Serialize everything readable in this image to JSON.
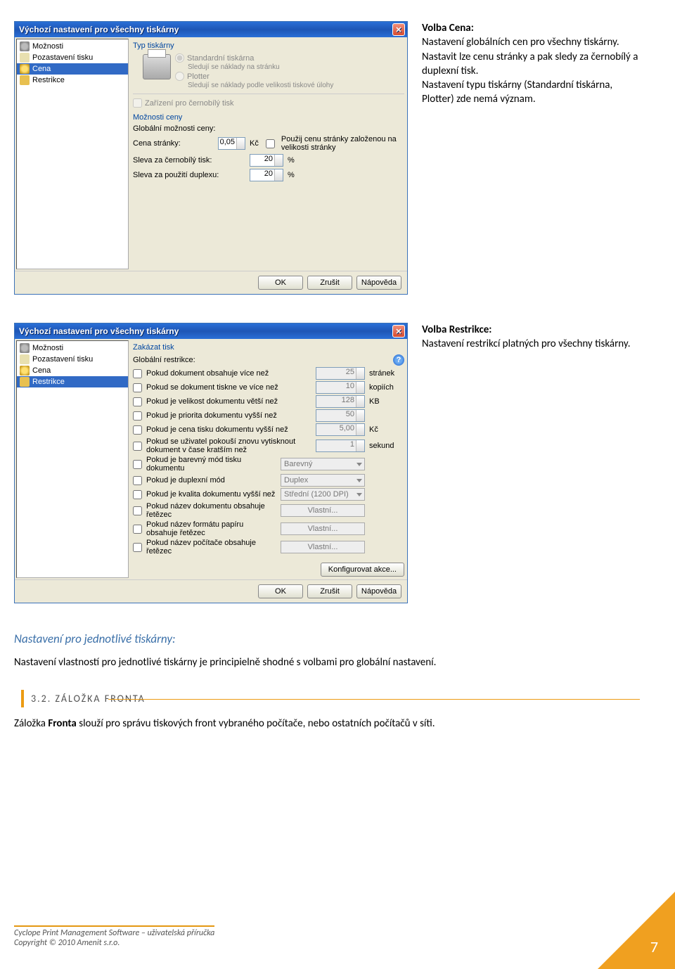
{
  "dialog1": {
    "title": "Výchozí nastavení pro všechny tiskárny",
    "sidebar": [
      "Možnosti",
      "Pozastavení tisku",
      "Cena",
      "Restrikce"
    ],
    "selected": 2,
    "group_type": "Typ tiskárny",
    "opt_standard": "Standardní tiskárna",
    "opt_standard_sub": "Sledují se náklady na stránku",
    "opt_plotter": "Plotter",
    "opt_plotter_sub": "Sledují se náklady podle velikosti tiskové úlohy",
    "chk_bw": "Zařízení pro černobílý tisk",
    "group_price": "Možnosti ceny",
    "lbl_global": "Globální možnosti ceny:",
    "lbl_price_page": "Cena stránky:",
    "val_price_page": "0,05",
    "unit_price": "Kč",
    "chk_usesize": "Použij cenu stránky založenou na velikosti stránky",
    "lbl_bw_discount": "Sleva za černobílý tisk:",
    "val_bw_discount": "20",
    "lbl_duplex_discount": "Sleva za použití duplexu:",
    "val_duplex_discount": "20",
    "unit_pct": "%",
    "btn_ok": "OK",
    "btn_cancel": "Zrušit",
    "btn_help": "Nápověda"
  },
  "text1": {
    "heading": "Volba Cena:",
    "p1": "Nastavení globálních cen pro všechny tiskárny.",
    "p2": "Nastavit lze cenu stránky a pak sledy za černobílý a duplexní tisk.",
    "p3": "Nastavení typu tiskárny (Standardní tiskárna, Plotter) zde nemá význam."
  },
  "dialog2": {
    "title": "Výchozí nastavení pro všechny tiskárny",
    "sidebar": [
      "Možnosti",
      "Pozastavení tisku",
      "Cena",
      "Restrikce"
    ],
    "selected": 3,
    "group_block": "Zakázat tisk",
    "lbl_global": "Globální restrikce:",
    "rows": [
      {
        "lbl": "Pokud dokument obsahuje více než",
        "val": "25",
        "unit": "stránek"
      },
      {
        "lbl": "Pokud se dokument tiskne ve více než",
        "val": "10",
        "unit": "kopiích"
      },
      {
        "lbl": "Pokud je velikost dokumentu větší než",
        "val": "128",
        "unit": "KB"
      },
      {
        "lbl": "Pokud je priorita dokumentu vyšší než",
        "val": "50",
        "unit": ""
      },
      {
        "lbl": "Pokud je cena tisku dokumentu vyšší než",
        "val": "5,00",
        "unit": "Kč"
      },
      {
        "lbl": "Pokud se uživatel pokouší znovu vytisknout dokument v čase kratším než",
        "val": "1",
        "unit": "sekund"
      }
    ],
    "combo_rows": [
      {
        "lbl": "Pokud je barevný mód tisku dokumentu",
        "val": "Barevný"
      },
      {
        "lbl": "Pokud je duplexní mód",
        "val": "Duplex"
      },
      {
        "lbl": "Pokud je kvalita dokumentu vyšší než",
        "val": "Střední (1200 DPI)"
      }
    ],
    "btn_rows": [
      {
        "lbl": "Pokud název dokumentu obsahuje řetězec",
        "val": "Vlastní..."
      },
      {
        "lbl": "Pokud název formátu papíru obsahuje řetězec",
        "val": "Vlastní..."
      },
      {
        "lbl": "Pokud název počítače obsahuje řetězec",
        "val": "Vlastní..."
      }
    ],
    "btn_cfg": "Konfigurovat akce...",
    "btn_ok": "OK",
    "btn_cancel": "Zrušit",
    "btn_help": "Nápověda"
  },
  "text2": {
    "heading": "Volba Restrikce:",
    "p1": "Nastavení restrikcí platných pro všechny tiskárny."
  },
  "section_head": "Nastavení pro jednotlivé tiskárny:",
  "section_p": "Nastavení vlastností pro jednotlivé tiskárny je principielně shodné s volbami pro globální nastavení.",
  "numbered": "3.2. ZÁLOŽKA FRONTA",
  "after_numbered_pre": "Záložka ",
  "after_numbered_bold": "Fronta",
  "after_numbered_post": " slouží pro správu tiskových front vybraného počítače, nebo ostatních počítačů v síti.",
  "footer": {
    "l1": "Cyclope Print Management Software – uživatelská příručka",
    "l2": "Copyright © 2010 Amenit s.r.o."
  },
  "page": "7"
}
